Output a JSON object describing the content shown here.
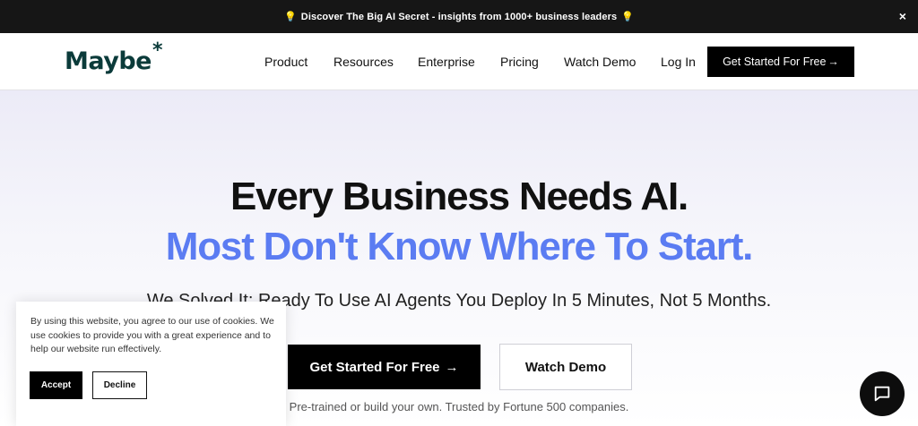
{
  "announcement": {
    "text": "Discover The Big AI Secret - insights from 1000+ business leaders",
    "icon_left": "lightbulb-icon",
    "icon_right": "lightbulb-icon",
    "close_label": "×"
  },
  "nav": {
    "logo_text": "Maybe",
    "logo_mark": "*",
    "items": [
      {
        "label": "Product"
      },
      {
        "label": "Resources"
      },
      {
        "label": "Enterprise"
      },
      {
        "label": "Pricing"
      },
      {
        "label": "Watch Demo"
      },
      {
        "label": "Log In"
      }
    ],
    "cta_label": "Get Started For Free",
    "cta_icon": "arrow-right-icon"
  },
  "hero": {
    "headline_line1": "Every Business Needs AI.",
    "headline_line2": "Most Don't Know Where To Start.",
    "subtitle": "We Solved It: Ready To Use AI Agents You Deploy In 5 Minutes, Not 5 Months.",
    "primary_button": "Get Started For Free",
    "primary_button_icon": "arrow-right-icon",
    "secondary_button": "Watch Demo",
    "trust_text": "Pre-trained or build your own. Trusted by Fortune 500 companies."
  },
  "cookie_banner": {
    "text": "By using this website, you agree to our use of cookies. We use cookies to provide you with a great experience and to help our website run effectively.",
    "accept_label": "Accept",
    "decline_label": "Decline"
  },
  "chat_widget": {
    "icon": "chat-bubble-icon"
  },
  "colors": {
    "accent_blue": "#5b7cf2",
    "brand_dark_teal": "#0b3b3a",
    "announcement_bg": "#161616",
    "button_black": "#000000"
  }
}
